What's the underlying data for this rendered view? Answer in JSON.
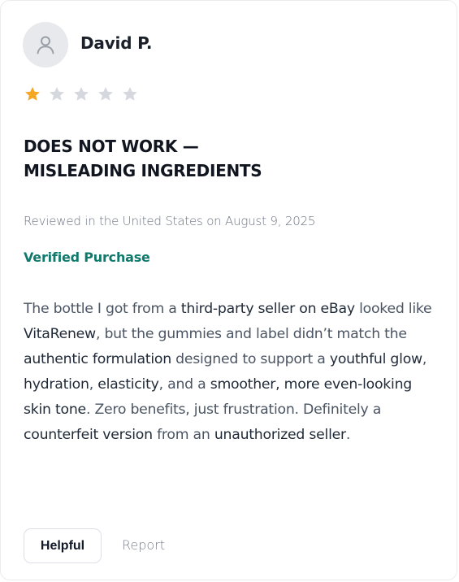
{
  "review": {
    "reviewer_name": "David P.",
    "rating": 1,
    "max_rating": 5,
    "title_line1": "DOES NOT WORK —",
    "title_line2": "MISLEADING INGREDIENTS",
    "meta": "Reviewed in the United States on August 9, 2025",
    "verified": "Verified Purchase",
    "body": [
      {
        "t": "The bottle I got from a ",
        "em": false
      },
      {
        "t": "third-party seller on eBay",
        "em": true
      },
      {
        "t": " looked like ",
        "em": false
      },
      {
        "t": "VitaRenew",
        "em": true
      },
      {
        "t": ", but the gummies and label didn’t match the ",
        "em": false
      },
      {
        "t": "authentic formulation",
        "em": true
      },
      {
        "t": " designed to support a ",
        "em": false
      },
      {
        "t": "youthful glow",
        "em": true
      },
      {
        "t": ", ",
        "em": false
      },
      {
        "t": "hydration",
        "em": true
      },
      {
        "t": ", ",
        "em": false
      },
      {
        "t": "elasticity",
        "em": true
      },
      {
        "t": ", and a ",
        "em": false
      },
      {
        "t": "smoother, more even-looking skin tone",
        "em": true
      },
      {
        "t": ". Zero benefits, just frustration. Definitely a ",
        "em": false
      },
      {
        "t": "counterfeit version",
        "em": true
      },
      {
        "t": " from an ",
        "em": false
      },
      {
        "t": "unauthorized seller",
        "em": true
      },
      {
        "t": ".",
        "em": false
      }
    ]
  },
  "actions": {
    "helpful_label": "Helpful",
    "report_label": "Report"
  },
  "icons": {
    "avatar": "user-icon",
    "star": "star-icon"
  },
  "colors": {
    "star_filled": "#f5a623",
    "star_empty": "#d5d8de",
    "verified": "#0f7a6b"
  }
}
